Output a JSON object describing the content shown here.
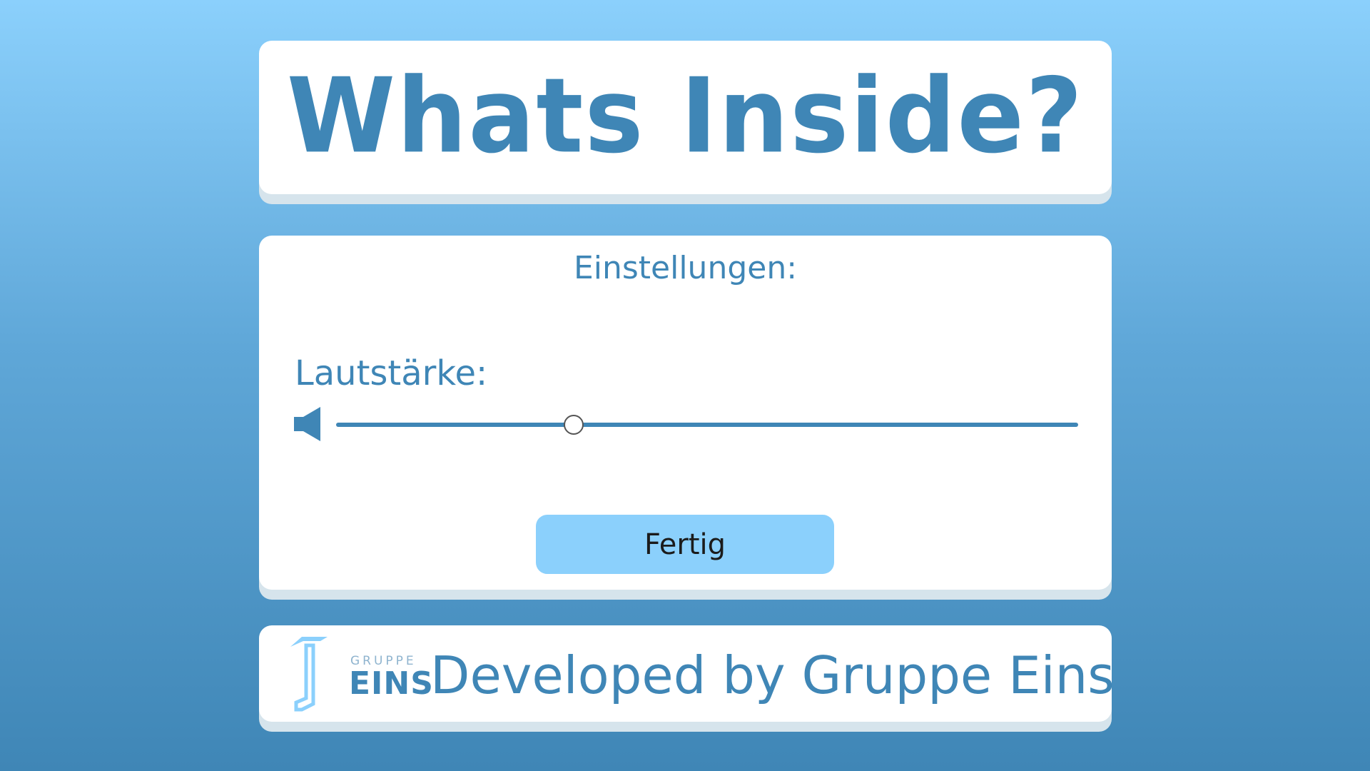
{
  "app": {
    "title": "Whats Inside?"
  },
  "settings": {
    "heading": "Einstellungen:",
    "volume_label": "Lautstärke:",
    "volume_level": 0.32,
    "speaker_icon": "speaker-icon",
    "done_button": "Fertig"
  },
  "footer": {
    "logo_small": "GRUPPE",
    "logo_big": "EINS",
    "credit": "Developed by Gruppe Eins"
  },
  "colors": {
    "accent": "#3f86b6",
    "button": "#8bd0fc",
    "background_top": "#8bd0fc",
    "background_bottom": "#3f86b6",
    "card": "#ffffff"
  }
}
